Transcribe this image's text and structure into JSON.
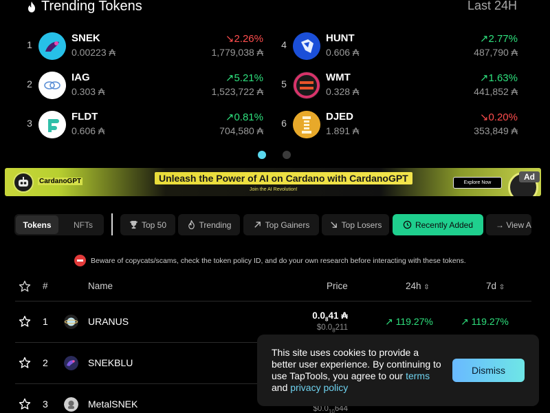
{
  "trending": {
    "title": "Trending Tokens",
    "period": "Last 24H",
    "currency_symbol": "₳",
    "tokens": [
      {
        "rank": "1",
        "symbol": "SNEK",
        "price": "0.00223 ₳",
        "change": "↘2.26%",
        "direction": "down",
        "volume": "1,779,038 ₳",
        "logo_color": "#27c0e8"
      },
      {
        "rank": "2",
        "symbol": "IAG",
        "price": "0.303 ₳",
        "change": "↗5.21%",
        "direction": "up",
        "volume": "1,523,722 ₳",
        "logo_color": "#ffffff"
      },
      {
        "rank": "3",
        "symbol": "FLDT",
        "price": "0.606 ₳",
        "change": "↗0.81%",
        "direction": "up",
        "volume": "704,580 ₳",
        "logo_color": "#ffffff"
      },
      {
        "rank": "4",
        "symbol": "HUNT",
        "price": "0.606 ₳",
        "change": "↗2.77%",
        "direction": "up",
        "volume": "487,790 ₳",
        "logo_color": "#1b4fd8"
      },
      {
        "rank": "5",
        "symbol": "WMT",
        "price": "0.328 ₳",
        "change": "↗1.63%",
        "direction": "up",
        "volume": "441,852 ₳",
        "logo_color": "#1a1a1a"
      },
      {
        "rank": "6",
        "symbol": "DJED",
        "price": "1.891 ₳",
        "change": "↘0.20%",
        "direction": "down",
        "volume": "353,849 ₳",
        "logo_color": "#e8a92a"
      }
    ],
    "page_index": "1 of 2"
  },
  "ad": {
    "brand": "CardanoGPT",
    "headline": "Unleash the Power of AI on Cardano with CardanoGPT",
    "subline": "Join the AI Revolution!",
    "cta": "Explore Now",
    "tag": "Ad"
  },
  "filters": {
    "segment": {
      "tokens": "Tokens",
      "nfts": "NFTs",
      "selected": "Tokens"
    },
    "pills": [
      {
        "label": "Top 50",
        "icon": "trophy-icon"
      },
      {
        "label": "Trending",
        "icon": "flame-icon"
      },
      {
        "label": "Top Gainers",
        "icon": "arrow-up-right-icon"
      },
      {
        "label": "Top Losers",
        "icon": "arrow-down-right-icon"
      },
      {
        "label": "Recently Added",
        "icon": "clock-icon",
        "active": true
      },
      {
        "label": "→ View A",
        "icon": "arrow-right-icon"
      }
    ],
    "active_color": "#1fcf8e"
  },
  "warning": "Beware of copycats/scams, check the token policy ID, and do your own research before interacting with these tokens.",
  "table": {
    "headers": {
      "rank": "#",
      "name": "Name",
      "price": "Price",
      "d1": "24h",
      "d7": "7d"
    },
    "rows": [
      {
        "rank": "1",
        "name": "URANUS",
        "price_main": "0.0",
        "price_sub": "8",
        "price_tail": "41 ₳",
        "usd_main": "$0.0",
        "usd_sub": "8",
        "usd_tail": "211",
        "d1": "↗ 119.27%",
        "d7": "↗ 119.27%"
      },
      {
        "rank": "2",
        "name": "SNEKBLU",
        "price_main": "",
        "price_sub": "",
        "price_tail": "",
        "usd_main": "",
        "usd_sub": "",
        "usd_tail": "",
        "d1": "",
        "d7": ""
      },
      {
        "rank": "3",
        "name": "MetalSNEK",
        "price_main": "",
        "price_sub": "",
        "price_tail": "",
        "usd_main": "$0.0",
        "usd_sub": "10",
        "usd_tail": "644",
        "d1": "",
        "d7": ""
      }
    ]
  },
  "cookie": {
    "text": "This site uses cookies to provide a better user experience. By continuing to use TapTools, you agree to our",
    "link_terms": "terms",
    "and": "and",
    "link_privacy": "privacy policy",
    "dismiss": "Dismiss"
  }
}
